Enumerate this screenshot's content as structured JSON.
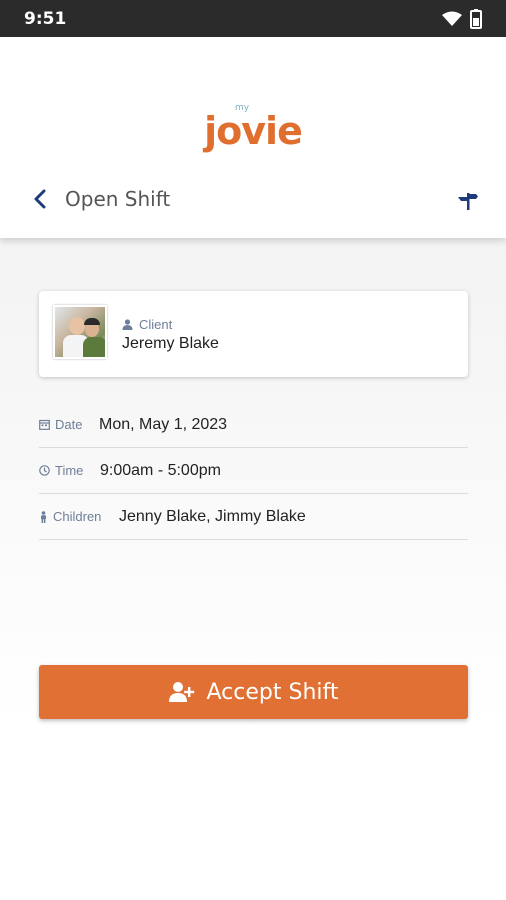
{
  "status_bar": {
    "time": "9:51"
  },
  "header": {
    "logo_small": "my",
    "logo_main": "jovie",
    "title": "Open Shift"
  },
  "client_card": {
    "label": "Client",
    "name": "Jeremy Blake"
  },
  "details": [
    {
      "label": "Date",
      "value": "Mon, May 1, 2023"
    },
    {
      "label": "Time",
      "value": "9:00am - 5:00pm"
    },
    {
      "label": "Children",
      "value": "Jenny Blake, Jimmy Blake"
    }
  ],
  "accept_button": {
    "label": "Accept Shift"
  },
  "colors": {
    "accent": "#e07034",
    "label": "#6e7f99",
    "nav": "#1f3a7a"
  }
}
